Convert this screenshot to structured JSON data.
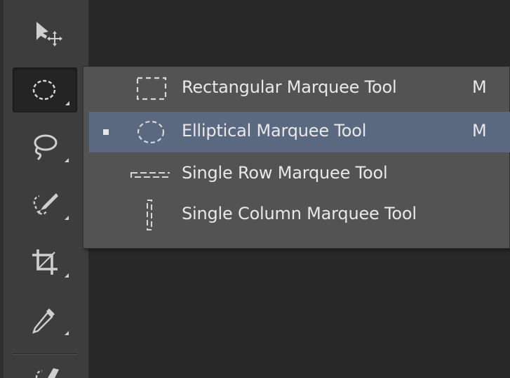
{
  "toolbar": {
    "tools": [
      {
        "icon": "move-icon",
        "active": false
      },
      {
        "icon": "elliptical-marquee-icon",
        "active": true
      },
      {
        "icon": "lasso-icon",
        "active": false
      },
      {
        "icon": "quick-selection-icon",
        "active": false
      },
      {
        "icon": "crop-icon",
        "active": false
      },
      {
        "icon": "eyedropper-icon",
        "active": false
      }
    ]
  },
  "flyout": {
    "items": [
      {
        "label": "Rectangular Marquee Tool",
        "shortcut": "M",
        "icon": "rectangular-marquee-icon",
        "selected": false
      },
      {
        "label": "Elliptical Marquee Tool",
        "shortcut": "M",
        "icon": "elliptical-marquee-icon",
        "selected": true
      },
      {
        "label": "Single Row Marquee Tool",
        "shortcut": "",
        "icon": "single-row-marquee-icon",
        "selected": false
      },
      {
        "label": "Single Column Marquee Tool",
        "shortcut": "",
        "icon": "single-column-marquee-icon",
        "selected": false
      }
    ]
  },
  "colors": {
    "toolbar_bg": "#3d3d3d",
    "canvas_bg": "#282828",
    "flyout_bg": "#535353",
    "selected_bg": "#5a6880",
    "text": "#e8e8e8"
  }
}
